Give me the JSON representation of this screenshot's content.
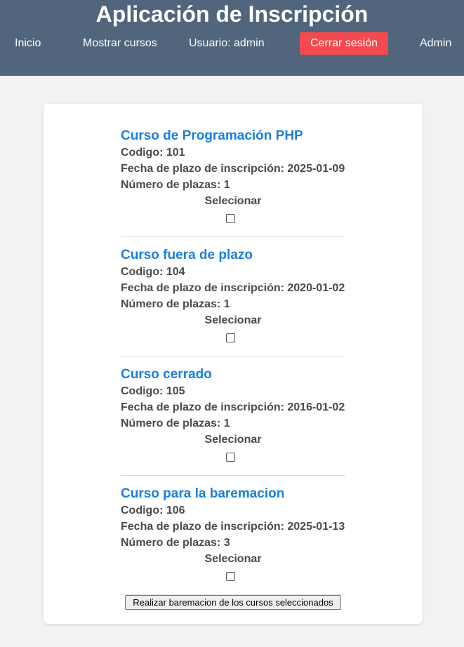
{
  "header": {
    "title": "Aplicación de Inscripción",
    "nav": {
      "home": "Inicio",
      "courses": "Mostrar cursos",
      "user": "Usuario: admin",
      "logout": "Cerrar sesión",
      "admin": "Admin"
    },
    "colors": {
      "header_bg": "#51657d",
      "logout_bg": "#f44a4f"
    }
  },
  "courses": [
    {
      "title": "Curso de Programación PHP",
      "code": "Codigo: 101",
      "deadline": "Fecha de plazo de inscripción: 2025-01-09",
      "places": "Número de plazas: 1",
      "select_label": "Selecionar",
      "checked": false
    },
    {
      "title": "Curso fuera de plazo",
      "code": "Codigo: 104",
      "deadline": "Fecha de plazo de inscripción: 2020-01-02",
      "places": "Número de plazas: 1",
      "select_label": "Selecionar",
      "checked": false
    },
    {
      "title": "Curso cerrado",
      "code": "Codigo: 105",
      "deadline": "Fecha de plazo de inscripción: 2016-01-02",
      "places": "Número de plazas: 1",
      "select_label": "Selecionar",
      "checked": false
    },
    {
      "title": "Curso para la baremacion",
      "code": "Codigo: 106",
      "deadline": "Fecha de plazo de inscripción: 2025-01-13",
      "places": "Número de plazas: 3",
      "select_label": "Selecionar",
      "checked": false
    }
  ],
  "submit_label": "Realizar baremacion de los cursos seleccionados",
  "colors": {
    "course_title": "#1a7fdc",
    "page_bg": "#f2f2f2"
  }
}
